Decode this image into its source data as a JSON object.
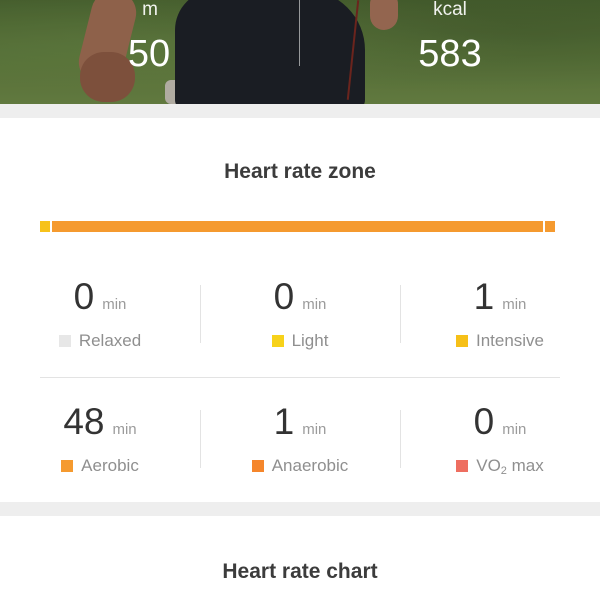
{
  "hero": {
    "stats": [
      {
        "unit": "m",
        "value": "50"
      },
      {
        "unit": "kcal",
        "value": "583"
      }
    ]
  },
  "heart_rate_zone": {
    "title": "Heart rate zone",
    "bar_segments": [
      {
        "zone": "Light",
        "minutes": 1,
        "color": "#f7c21b"
      },
      {
        "zone": "Aerobic",
        "minutes": 48,
        "color": "#f59a2f"
      },
      {
        "zone": "Anaerobic",
        "minutes": 1,
        "color": "#f59a2f"
      }
    ],
    "zones": [
      {
        "value": "0",
        "unit": "min",
        "label": "Relaxed",
        "color": "#e7e7e7"
      },
      {
        "value": "0",
        "unit": "min",
        "label": "Light",
        "color": "#f7d21a"
      },
      {
        "value": "1",
        "unit": "min",
        "label": "Intensive",
        "color": "#f6c018"
      },
      {
        "value": "48",
        "unit": "min",
        "label": "Aerobic",
        "color": "#f59a2f"
      },
      {
        "value": "1",
        "unit": "min",
        "label": "Anaerobic",
        "color": "#f5862b"
      },
      {
        "value": "0",
        "unit": "min",
        "label_main": "VO",
        "label_sub": "2",
        "label_tail": " max",
        "color": "#ee6e60"
      }
    ]
  },
  "heart_rate_chart": {
    "title": "Heart rate chart"
  }
}
